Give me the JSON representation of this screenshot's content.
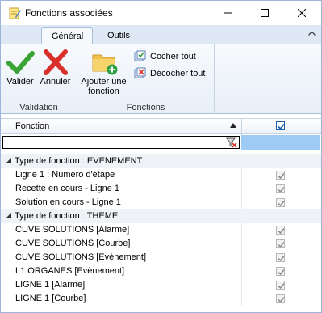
{
  "window": {
    "title": "Fonctions associées",
    "controls": {
      "minimize": "—",
      "maximize": "☐",
      "close": "✕"
    }
  },
  "ribbon": {
    "tabs": [
      {
        "label": "Général",
        "active": true
      },
      {
        "label": "Outils",
        "active": false
      }
    ],
    "groups": {
      "validation": {
        "label": "Validation",
        "valider": "Valider",
        "annuler": "Annuler"
      },
      "fonctions": {
        "label": "Fonctions",
        "ajouter_line1": "Ajouter une",
        "ajouter_line2": "fonction",
        "cocher_tout": "Cocher tout",
        "decocher_tout": "Décocher tout"
      }
    }
  },
  "grid": {
    "column_fonction": "Fonction",
    "groups": [
      {
        "label": "Type de fonction :  EVENEMENT",
        "items": [
          {
            "label": "Ligne 1 : Numéro d'étape",
            "checked": true
          },
          {
            "label": "Recette en cours - Ligne 1",
            "checked": true
          },
          {
            "label": "Solution en cours - Ligne 1",
            "checked": true
          }
        ]
      },
      {
        "label": "Type de fonction :  THEME",
        "items": [
          {
            "label": "CUVE SOLUTIONS [Alarme]",
            "checked": true
          },
          {
            "label": "CUVE SOLUTIONS [Courbe]",
            "checked": true
          },
          {
            "label": "CUVE SOLUTIONS [Evènement]",
            "checked": true
          },
          {
            "label": "L1 ORGANES [Evènement]",
            "checked": true
          },
          {
            "label": "LIGNE 1 [Alarme]",
            "checked": true
          },
          {
            "label": "LIGNE 1 [Courbe]",
            "checked": true
          }
        ]
      }
    ]
  },
  "colors": {
    "accent": "#9ecbf4",
    "ribbon": "#dfe9f5",
    "check_green": "#3aa335",
    "cross_red": "#d9302c",
    "folder": "#f2c04a"
  }
}
